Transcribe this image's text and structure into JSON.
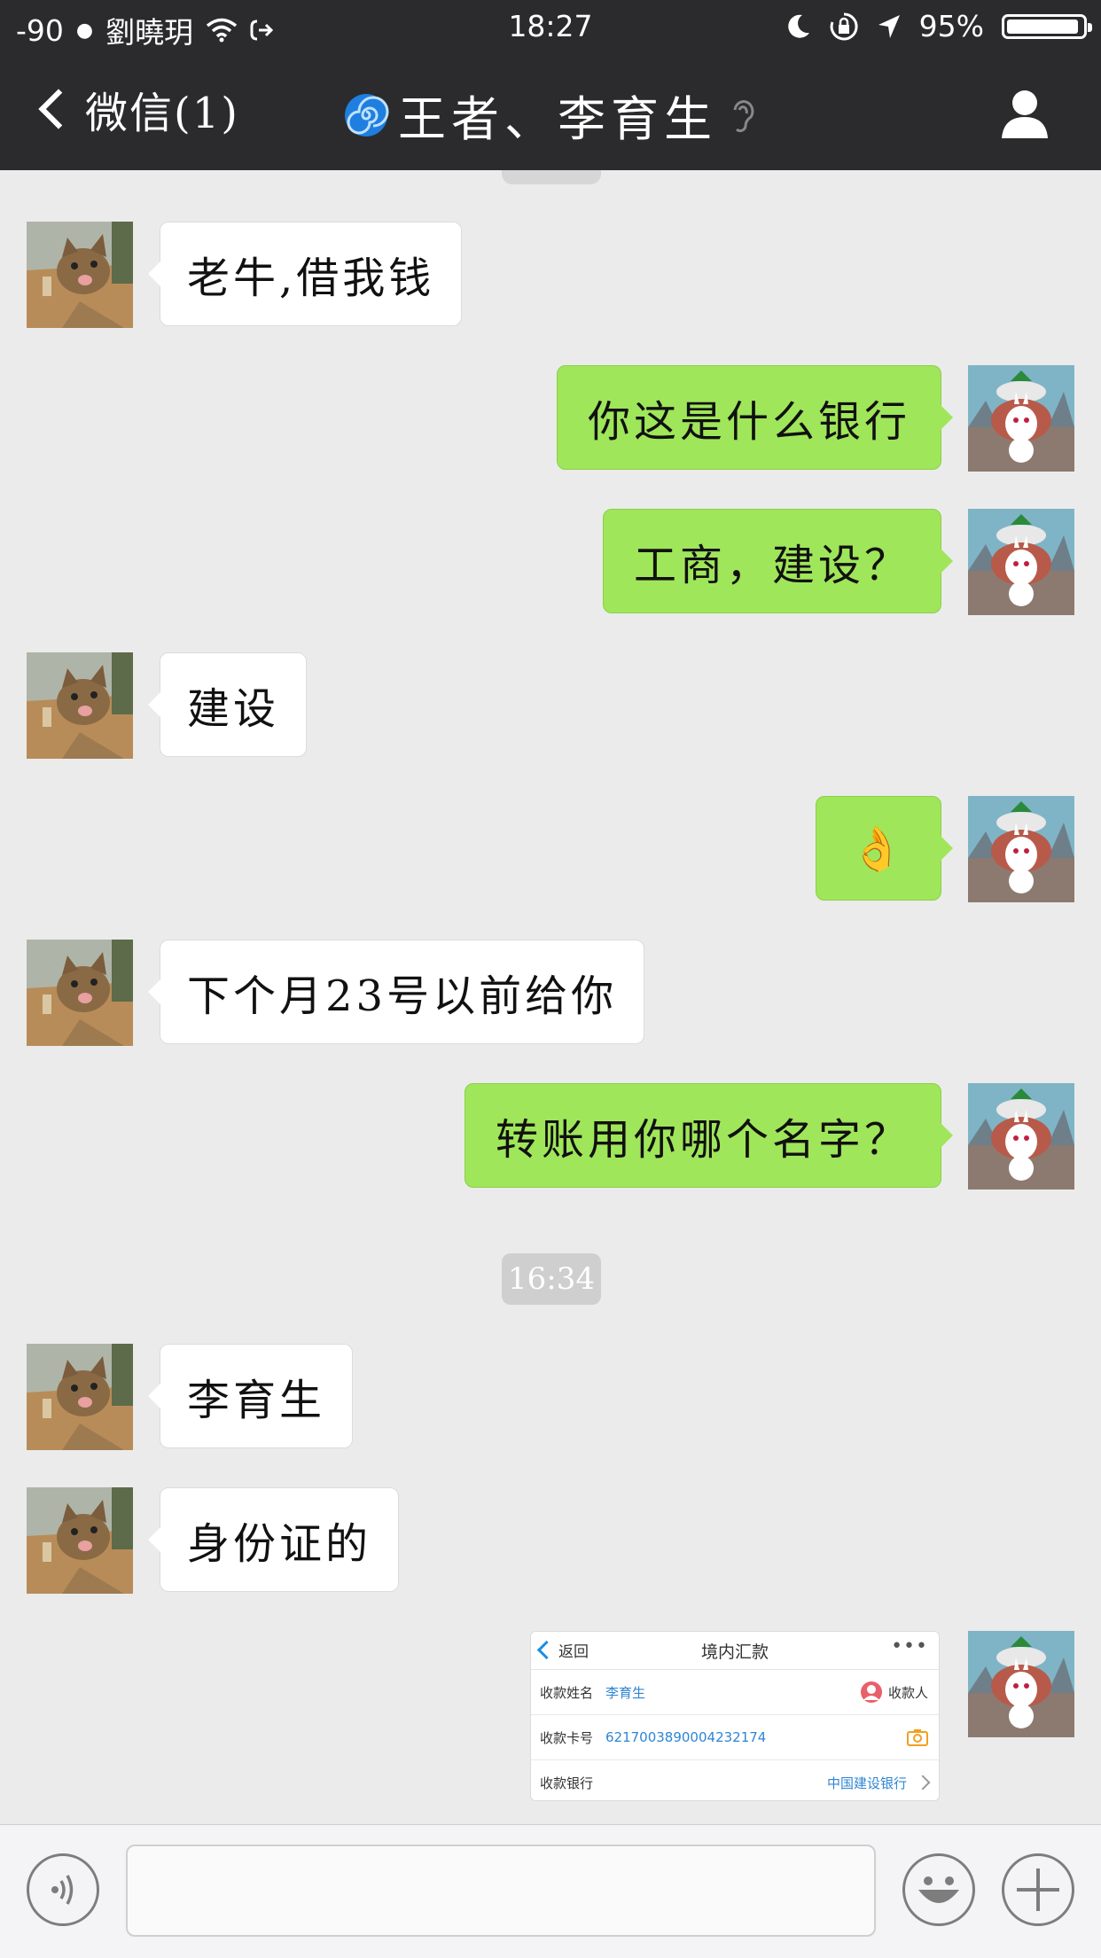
{
  "status_bar": {
    "signal": "-90",
    "carrier": "劉曉玥",
    "time": "18:27",
    "battery": "95%",
    "battery_level": 0.95
  },
  "nav": {
    "back_label": "微信(1)",
    "title": "王者、李育生"
  },
  "messages": [
    {
      "side": "in",
      "type": "text",
      "text": "老牛,借我钱"
    },
    {
      "side": "out",
      "type": "text",
      "text": "你这是什么银行"
    },
    {
      "side": "out",
      "type": "text",
      "text": "工商，建设？"
    },
    {
      "side": "in",
      "type": "text",
      "text": "建设"
    },
    {
      "side": "out",
      "type": "emoji",
      "text": "👌"
    },
    {
      "side": "in",
      "type": "text",
      "text": "下个月23号以前给你"
    },
    {
      "side": "out",
      "type": "text",
      "text": "转账用你哪个名字？"
    },
    {
      "type": "time",
      "text": "16:34"
    },
    {
      "side": "in",
      "type": "text",
      "text": "李育生"
    },
    {
      "side": "in",
      "type": "text",
      "text": "身份证的"
    },
    {
      "side": "out",
      "type": "image"
    }
  ],
  "transfer_screenshot": {
    "back_label": "返回",
    "title": "境内汇款",
    "more": "•••",
    "rows": [
      {
        "label": "收款姓名",
        "value": "李育生",
        "right": "收款人"
      },
      {
        "label": "收款卡号",
        "value": "6217003890004232174",
        "right": ""
      },
      {
        "label": "收款银行",
        "value": "",
        "right": "中国建设银行"
      }
    ]
  },
  "colors": {
    "outgoing_bubble": "#9fe65a",
    "incoming_bubble": "#ffffff",
    "nav_background": "#2b2b2d",
    "chat_background": "#ebebeb"
  },
  "icons": {
    "back": "chevron-left-icon",
    "title_prefix": "spiral-icon",
    "title_suffix": "ear-icon",
    "profile": "person-icon",
    "voice": "voice-icon",
    "emoji": "smiley-icon",
    "more": "plus-icon"
  }
}
